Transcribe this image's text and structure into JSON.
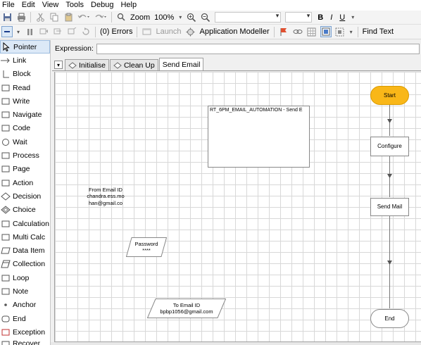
{
  "menu": [
    "File",
    "Edit",
    "View",
    "Tools",
    "Debug",
    "Help"
  ],
  "toolbar1": {
    "zoom_label": "Zoom",
    "zoom_value": "100%",
    "font_name": "",
    "font_size": "",
    "bold": "B",
    "italic": "I",
    "underline": "U"
  },
  "toolbar2": {
    "errors": "(0) Errors",
    "launch": "Launch",
    "app_modeller": "Application Modeller",
    "find_text": "Find Text"
  },
  "palette": [
    {
      "label": "Pointer",
      "icon": "pointer-icon",
      "selected": true
    },
    {
      "label": "Link",
      "icon": "link-icon"
    },
    {
      "label": "Block",
      "icon": "block-icon"
    },
    {
      "label": "Read",
      "icon": "read-icon"
    },
    {
      "label": "Write",
      "icon": "write-icon"
    },
    {
      "label": "Navigate",
      "icon": "navigate-icon"
    },
    {
      "label": "Code",
      "icon": "code-icon"
    },
    {
      "label": "Wait",
      "icon": "wait-icon"
    },
    {
      "label": "Process",
      "icon": "process-icon"
    },
    {
      "label": "Page",
      "icon": "page-icon"
    },
    {
      "label": "Action",
      "icon": "action-icon"
    },
    {
      "label": "Decision",
      "icon": "decision-icon"
    },
    {
      "label": "Choice",
      "icon": "choice-icon"
    },
    {
      "label": "Calculation",
      "icon": "calculation-icon"
    },
    {
      "label": "Multi Calc",
      "icon": "multi-calc-icon"
    },
    {
      "label": "Data Item",
      "icon": "data-item-icon"
    },
    {
      "label": "Collection",
      "icon": "collection-icon"
    },
    {
      "label": "Loop",
      "icon": "loop-icon"
    },
    {
      "label": "Note",
      "icon": "note-icon"
    },
    {
      "label": "Anchor",
      "icon": "anchor-icon"
    },
    {
      "label": "End",
      "icon": "end-icon"
    },
    {
      "label": "Exception",
      "icon": "exception-icon"
    },
    {
      "label": "Recover",
      "icon": "recover-icon"
    }
  ],
  "expression": {
    "label": "Expression:",
    "value": ""
  },
  "tabs": [
    "Initialise",
    "Clean Up",
    "Send Email"
  ],
  "active_tab": "Send Email",
  "canvas": {
    "start": "Start",
    "configure": "Configure",
    "send_mail": "Send Mail",
    "end": "End",
    "note_title": "RT_6PM_EMAIL_AUTOMATION - Send E",
    "from_email_label": "From Email ID",
    "from_email_value_1": "chandra.ess.mo",
    "from_email_value_2": "han@gmail.co",
    "password_label": "Password",
    "password_value": "****",
    "to_email_label": "To Email ID",
    "to_email_value": "bpbp1056@gmail.com"
  },
  "colors": {
    "start_fill": "#f9b718",
    "accent_selected": "#dce9f7"
  }
}
